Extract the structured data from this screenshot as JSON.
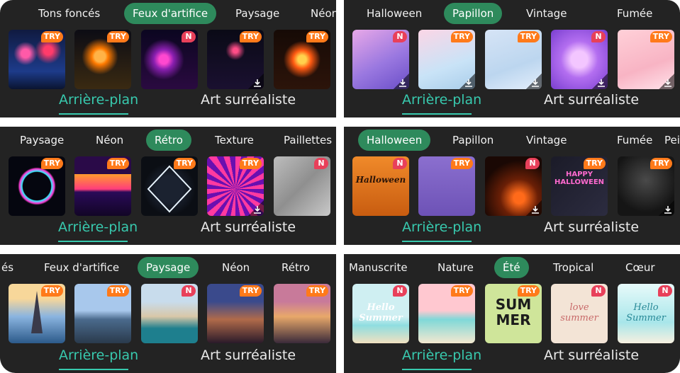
{
  "bottom": {
    "tab1": "Arrière-plan",
    "tab2": "Art surréaliste",
    "accent": "#38c9ae"
  },
  "selected_tab_color": "#2e8a5c",
  "badges": {
    "try": "TRY",
    "new": "N"
  },
  "panels": [
    {
      "tabs": [
        "Tons foncés",
        "Feux d'artifice",
        "Paysage",
        "Néon"
      ],
      "selected": "Feux d'artifice",
      "thumbs": [
        {
          "badge": "TRY",
          "download": false,
          "image": "fireworks-red-blue"
        },
        {
          "badge": "TRY",
          "download": false,
          "image": "fireworks-golden"
        },
        {
          "badge": "N",
          "download": false,
          "image": "fireworks-purple"
        },
        {
          "badge": "TRY",
          "download": true,
          "image": "fireworks-dark"
        },
        {
          "badge": "TRY",
          "download": false,
          "image": "fireworks-orange"
        }
      ]
    },
    {
      "tabs": [
        "Halloween",
        "Papillon",
        "Vintage",
        "Fumée"
      ],
      "selected": "Papillon",
      "thumbs": [
        {
          "badge": "N",
          "download": true,
          "image": "butterflies-purple"
        },
        {
          "badge": "TRY",
          "download": true,
          "image": "butterflies-pastel"
        },
        {
          "badge": "TRY",
          "download": true,
          "image": "butterflies-blue"
        },
        {
          "badge": "N",
          "download": true,
          "image": "butterfly-glow"
        },
        {
          "badge": "TRY",
          "download": true,
          "image": "butterfly-pink"
        }
      ]
    },
    {
      "tabs": [
        "Paysage",
        "Néon",
        "Rétro",
        "Texture",
        "Paillettes"
      ],
      "selected": "Rétro",
      "thumbs": [
        {
          "badge": "TRY",
          "download": false,
          "image": "neon-ring"
        },
        {
          "badge": "TRY",
          "download": false,
          "image": "retro-sunset"
        },
        {
          "badge": "TRY",
          "download": false,
          "image": "neon-diamond"
        },
        {
          "badge": "TRY",
          "download": true,
          "image": "spiral-pink"
        },
        {
          "badge": "N",
          "download": false,
          "image": "concrete-wall"
        }
      ]
    },
    {
      "tabs": [
        "Halloween",
        "Papillon",
        "Vintage",
        "Fumée",
        "Pei"
      ],
      "selected": "Halloween",
      "thumbs": [
        {
          "badge": "N",
          "download": false,
          "image": "halloween-orange",
          "text": "Halloween"
        },
        {
          "badge": "TRY",
          "download": false,
          "image": "halloween-pumpkins"
        },
        {
          "badge": "N",
          "download": true,
          "image": "halloween-candle"
        },
        {
          "badge": "TRY",
          "download": false,
          "image": "happy-halloween-neon",
          "text": "HAPPY HALLOWEEN"
        },
        {
          "badge": "TRY",
          "download": true,
          "image": "halloween-smoke"
        }
      ]
    },
    {
      "tabs": [
        "és",
        "Feux d'artifice",
        "Paysage",
        "Néon",
        "Rétro"
      ],
      "selected": "Paysage",
      "thumbs": [
        {
          "badge": "TRY",
          "download": false,
          "image": "paris-eiffel"
        },
        {
          "badge": "TRY",
          "download": false,
          "image": "bridge-city"
        },
        {
          "badge": "N",
          "download": false,
          "image": "venice-canal"
        },
        {
          "badge": "TRY",
          "download": false,
          "image": "city-night"
        },
        {
          "badge": "TRY",
          "download": false,
          "image": "rome-sunset"
        }
      ]
    },
    {
      "tabs": [
        "Manuscrite",
        "Nature",
        "Été",
        "Tropical",
        "Cœur"
      ],
      "selected": "Été",
      "thumbs": [
        {
          "badge": "N",
          "download": false,
          "image": "hello-summer-beach",
          "text": "Hello Summer"
        },
        {
          "badge": "TRY",
          "download": false,
          "image": "beach-pink"
        },
        {
          "badge": "TRY",
          "download": false,
          "image": "sum-mer-green",
          "text": "SUM MER"
        },
        {
          "badge": "N",
          "download": false,
          "image": "love-summer",
          "text": "love summer"
        },
        {
          "badge": "N",
          "download": false,
          "image": "hello-summer-aqua",
          "text": "Hello Summer"
        }
      ]
    }
  ]
}
